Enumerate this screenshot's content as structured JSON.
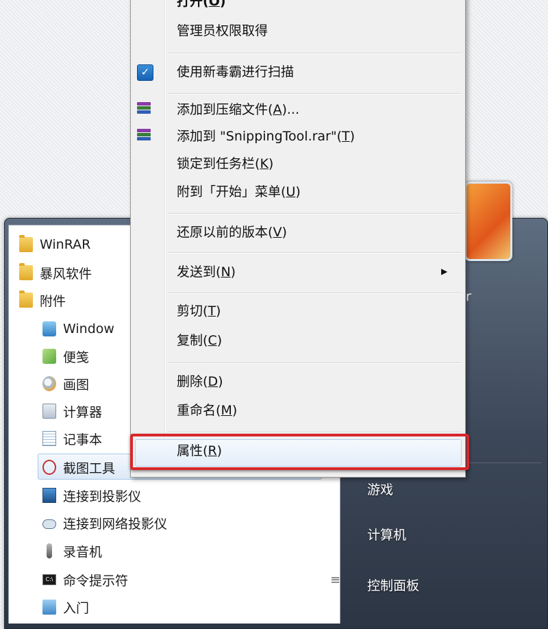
{
  "start_menu": {
    "programs": [
      {
        "label": "WinRAR",
        "icon": "folder-icon"
      },
      {
        "label": "暴风软件",
        "icon": "folder-icon"
      },
      {
        "label": "附件",
        "icon": "folder-icon"
      },
      {
        "label": "Window",
        "icon": "windows-update-icon"
      },
      {
        "label": "便笺",
        "icon": "sticky-notes-icon"
      },
      {
        "label": "画图",
        "icon": "paint-icon"
      },
      {
        "label": "计算器",
        "icon": "calculator-icon"
      },
      {
        "label": "记事本",
        "icon": "notepad-icon"
      },
      {
        "label": "截图工具",
        "icon": "snipping-tool-icon"
      },
      {
        "label": "连接到投影仪",
        "icon": "projector-icon"
      },
      {
        "label": "连接到网络投影仪",
        "icon": "network-projector-icon"
      },
      {
        "label": "录音机",
        "icon": "microphone-icon"
      },
      {
        "label": "命令提示符",
        "icon": "cmd-icon"
      },
      {
        "label": "入门",
        "icon": "getting-started-icon"
      }
    ],
    "right_items": [
      "游戏",
      "计算机",
      "控制面板"
    ],
    "partial_username": "r",
    "scroll_grip": "≡"
  },
  "context_menu": {
    "items": [
      {
        "label": "打开",
        "key": "O"
      },
      {
        "label": "管理员权限取得"
      },
      {
        "label": "使用新毒霸进行扫描",
        "icon": "antivirus-scan-icon"
      },
      {
        "label": "添加到压缩文件",
        "key": "A",
        "suffix": "...",
        "icon": "winrar-icon"
      },
      {
        "label": "添加到 \"SnippingTool.rar\"",
        "key": "T",
        "icon": "winrar-icon"
      },
      {
        "label": "锁定到任务栏",
        "key": "K"
      },
      {
        "label": "附到「开始」菜单",
        "key": "U"
      },
      {
        "label": "还原以前的版本",
        "key": "V"
      },
      {
        "label": "发送到",
        "key": "N",
        "submenu": true
      },
      {
        "label": "剪切",
        "key": "T"
      },
      {
        "label": "复制",
        "key": "C"
      },
      {
        "label": "删除",
        "key": "D"
      },
      {
        "label": "重命名",
        "key": "M"
      },
      {
        "label": "属性",
        "key": "R",
        "highlighted": true
      }
    ],
    "submenu_arrow": "▶"
  },
  "colors": {
    "highlight_box": "#d9262b",
    "start_menu_right": "#3b4657",
    "menu_bg": "#f0f0f0"
  }
}
